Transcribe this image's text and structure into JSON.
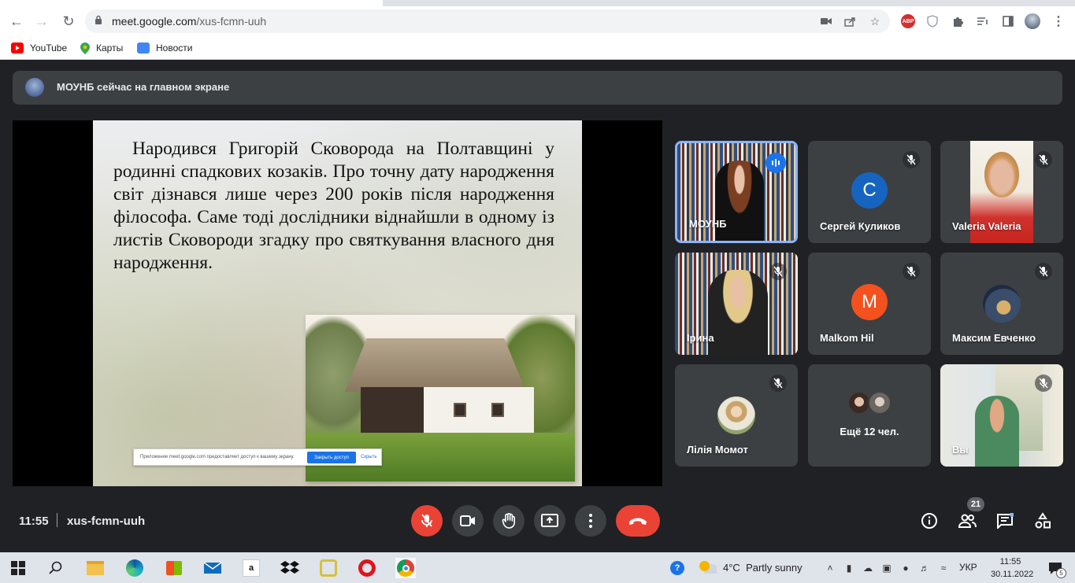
{
  "browser": {
    "url_host": "meet.google.com",
    "url_path": "/xus-fcmn-uuh",
    "bookmarks": [
      {
        "label": "YouTube",
        "icon": "youtube-icon"
      },
      {
        "label": "Карты",
        "icon": "maps-icon"
      },
      {
        "label": "Новости",
        "icon": "news-icon"
      }
    ],
    "extensions": [
      "video-camera-icon",
      "share-icon",
      "star-icon",
      "abp-icon",
      "shield-icon",
      "puzzle-icon",
      "reading-list-icon",
      "side-panel-icon",
      "profile-avatar",
      "more-vert-icon"
    ],
    "abp_label": "ABP"
  },
  "banner": {
    "text": "МОУНБ сейчас на главном экране"
  },
  "slide": {
    "body": "Народився Григорій Сковорода на Полтавщині у родинні спадкових козаків. Про точну дату народження світ дізнався лише через 200 років після народження філософа. Саме тоді дослідники віднайшли в одному із листів Сковороди згадку про святкування власного дня народження.",
    "share_message": "Приложение meet.google.com предоставляет доступ к вашему экрану.",
    "share_stop": "Закрыть доступ",
    "share_hide": "Скрыть"
  },
  "participants": [
    {
      "name": "МОУНБ",
      "speaking": true
    },
    {
      "name": "Сергей Куликов",
      "letter": "С",
      "color": "#1565c0",
      "muted": true
    },
    {
      "name": "Valeria Valeria",
      "muted": true
    },
    {
      "name": "Ірина",
      "muted": true
    },
    {
      "name": "Malkom Hil",
      "letter": "M",
      "color": "#f4511e",
      "muted": true
    },
    {
      "name": "Максим Евченко",
      "muted": true
    },
    {
      "name": "Лілія Момот",
      "muted": true
    },
    {
      "name": "Ещё 12 чел."
    },
    {
      "name": "Вы",
      "muted": true
    }
  ],
  "bottom": {
    "time": "11:55",
    "meeting_code": "xus-fcmn-uuh",
    "participant_count": "21"
  },
  "taskbar": {
    "weather_temp": "4°C",
    "weather_desc": "Partly sunny",
    "language": "УКР",
    "time": "11:55",
    "date": "30.11.2022",
    "notifications": "5"
  }
}
